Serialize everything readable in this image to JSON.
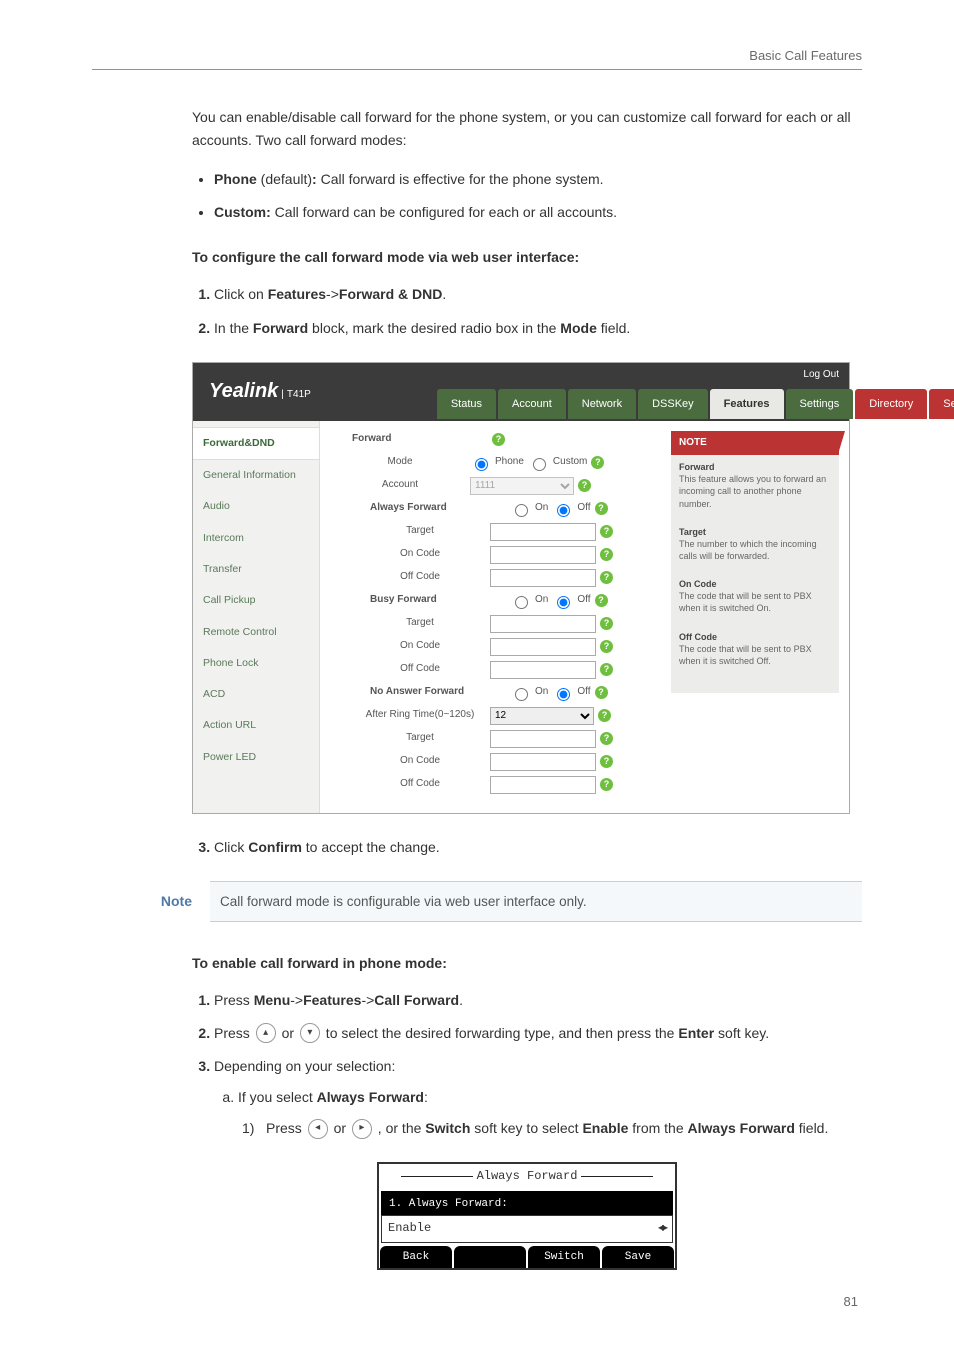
{
  "running_header": "Basic Call Features",
  "intro": "You can enable/disable call forward for the phone system, or you can customize call forward for each or all accounts. Two call forward modes:",
  "bullets": [
    {
      "bold": "Phone",
      "after": " (default)",
      "bold2": ":",
      "rest": " Call forward is effective for the phone system."
    },
    {
      "bold": "Custom:",
      "after": "",
      "bold2": "",
      "rest": " Call forward can be configured for each or all accounts."
    }
  ],
  "heading1": "To configure the call forward mode via web user interface:",
  "steps1": {
    "s1a": "Click on ",
    "s1b": "Features",
    "s1c": "->",
    "s1d": "Forward & DND",
    "s1e": ".",
    "s2a": "In the ",
    "s2b": "Forward",
    "s2c": " block, mark the desired radio box in the ",
    "s2d": "Mode",
    "s2e": " field."
  },
  "webui": {
    "logo": "Yealink",
    "logo_model": "T41P",
    "logout": "Log Out",
    "tabs": [
      "Status",
      "Account",
      "Network",
      "DSSKey",
      "Features",
      "Settings",
      "Directory",
      "Security"
    ],
    "active_tab": 4,
    "sidebar": [
      "Forward&DND",
      "General Information",
      "Audio",
      "Intercom",
      "Transfer",
      "Call Pickup",
      "Remote Control",
      "Phone Lock",
      "ACD",
      "Action URL",
      "Power LED"
    ],
    "active_side": 0,
    "form": {
      "forward_heading": "Forward",
      "mode": "Mode",
      "mode_phone": "Phone",
      "mode_custom": "Custom",
      "account": "Account",
      "account_val": "1111",
      "always": "Always Forward",
      "on": "On",
      "off": "Off",
      "target": "Target",
      "oncode": "On Code",
      "offcode": "Off Code",
      "busy": "Busy Forward",
      "noanswer": "No Answer Forward",
      "afterring": "After Ring Time(0~120s)",
      "afterring_val": "12"
    },
    "note": {
      "head": "NOTE",
      "items": [
        {
          "t": "Forward",
          "d": "This feature allows you to forward an incoming call to another phone number."
        },
        {
          "t": "Target",
          "d": "The number to which the incoming calls will be forwarded."
        },
        {
          "t": "On Code",
          "d": "The code that will be sent to PBX when it is switched On."
        },
        {
          "t": "Off Code",
          "d": "The code that will be sent to PBX when it is switched Off."
        }
      ]
    }
  },
  "step3": {
    "a": "Click ",
    "b": "Confirm",
    "c": " to accept the change."
  },
  "note_label": "Note",
  "note_text": "Call forward mode is configurable via web user interface only.",
  "heading2": "To enable call forward in phone mode:",
  "steps2": {
    "s1a": "Press ",
    "s1b": "Menu",
    "s1c": "->",
    "s1d": "Features",
    "s1e": "->",
    "s1f": "Call Forward",
    "s1g": ".",
    "s2a": "Press ",
    "s2b": " or ",
    "s2c": " to select the desired forwarding type, and then press the ",
    "s2d": "Enter",
    "s2e": "soft key.",
    "s3": "Depending on your selection:",
    "s3a_a": "If you select ",
    "s3a_b": "Always Forward",
    "s3a_c": ":",
    "s3a1_a": "Press ",
    "s3a1_b": " or ",
    "s3a1_c": " , or the ",
    "s3a1_d": "Switch",
    "s3a1_e": " soft key to select ",
    "s3a1_f": "Enable",
    "s3a1_g": " from the ",
    "s3a1_h": "Always Forward",
    "s3a1_i": " field."
  },
  "lcd": {
    "title": "Always Forward",
    "row1": "1. Always Forward:",
    "row2": "Enable",
    "soft": [
      "Back",
      "",
      "Switch",
      "Save"
    ]
  },
  "pagenum": "81"
}
